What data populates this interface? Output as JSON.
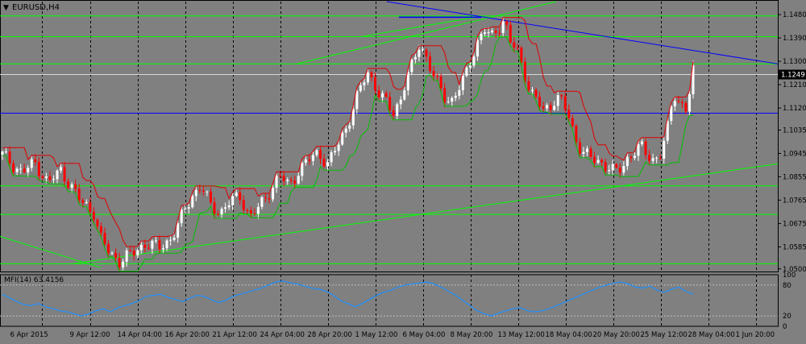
{
  "window": {
    "symbol_label": "EURUSD,H4",
    "current_price_label": "1.1249",
    "mfi_label": "MFI(14) 63.4156"
  },
  "colors": {
    "background": "#808080",
    "grid": "#000000",
    "bull_candle": "#ffffff",
    "bear_candle": "#ff0000",
    "green_lines": "#00ff00",
    "blue_lines": "#0000ff",
    "mfi_line": "#1e90ff"
  },
  "chart_data": [
    {
      "type": "candlestick",
      "symbol": "EURUSD",
      "timeframe": "H4",
      "y_ticks": [
        "1.1480",
        "1.1390",
        "1.1300",
        "1.1210",
        "1.1120",
        "1.1035",
        "1.0945",
        "1.0855",
        "1.0765",
        "1.0675",
        "1.0585",
        "1.0500"
      ],
      "ylim": [
        1.049,
        1.153
      ],
      "x_ticks": [
        "6 Apr 2015",
        "9 Apr 12:00",
        "14 Apr 04:00",
        "16 Apr 20:00",
        "21 Apr 12:00",
        "24 Apr 04:00",
        "28 Apr 20:00",
        "1 May 12:00",
        "6 May 04:00",
        "8 May 20:00",
        "13 May 12:00",
        "18 May 04:00",
        "20 May 20:00",
        "25 May 12:00",
        "28 May 04:00",
        "1 Jun 20:00"
      ],
      "price_path": [
        [
          0,
          1.094
        ],
        [
          6,
          1.087
        ],
        [
          10,
          1.091
        ],
        [
          14,
          1.083
        ],
        [
          18,
          1.088
        ],
        [
          24,
          1.076
        ],
        [
          28,
          1.072
        ],
        [
          30,
          1.062
        ],
        [
          33,
          1.056
        ],
        [
          36,
          1.053
        ],
        [
          40,
          1.056
        ],
        [
          44,
          1.06
        ],
        [
          48,
          1.058
        ],
        [
          52,
          1.062
        ],
        [
          55,
          1.07
        ],
        [
          58,
          1.078
        ],
        [
          61,
          1.082
        ],
        [
          64,
          1.074
        ],
        [
          67,
          1.072
        ],
        [
          70,
          1.076
        ],
        [
          73,
          1.078
        ],
        [
          76,
          1.07
        ],
        [
          79,
          1.074
        ],
        [
          82,
          1.08
        ],
        [
          85,
          1.086
        ],
        [
          88,
          1.082
        ],
        [
          91,
          1.088
        ],
        [
          94,
          1.092
        ],
        [
          97,
          1.095
        ],
        [
          100,
          1.09
        ],
        [
          103,
          1.098
        ],
        [
          106,
          1.106
        ],
        [
          108,
          1.113
        ],
        [
          110,
          1.12
        ],
        [
          112,
          1.126
        ],
        [
          114,
          1.122
        ],
        [
          116,
          1.116
        ],
        [
          118,
          1.114
        ],
        [
          120,
          1.11
        ],
        [
          122,
          1.115
        ],
        [
          124,
          1.123
        ],
        [
          126,
          1.129
        ],
        [
          128,
          1.137
        ],
        [
          130,
          1.132
        ],
        [
          132,
          1.125
        ],
        [
          134,
          1.12
        ],
        [
          136,
          1.116
        ],
        [
          138,
          1.115
        ],
        [
          140,
          1.119
        ],
        [
          142,
          1.124
        ],
        [
          144,
          1.132
        ],
        [
          146,
          1.138
        ],
        [
          148,
          1.142
        ],
        [
          150,
          1.139
        ],
        [
          152,
          1.143
        ],
        [
          154,
          1.146
        ],
        [
          156,
          1.137
        ],
        [
          158,
          1.134
        ],
        [
          160,
          1.127
        ],
        [
          162,
          1.118
        ],
        [
          164,
          1.115
        ],
        [
          166,
          1.111
        ],
        [
          168,
          1.113
        ],
        [
          170,
          1.116
        ],
        [
          172,
          1.114
        ],
        [
          174,
          1.108
        ],
        [
          176,
          1.1
        ],
        [
          178,
          1.095
        ],
        [
          180,
          1.093
        ],
        [
          182,
          1.092
        ],
        [
          184,
          1.091
        ],
        [
          186,
          1.089
        ],
        [
          188,
          1.087
        ],
        [
          190,
          1.089
        ],
        [
          192,
          1.093
        ],
        [
          194,
          1.095
        ],
        [
          196,
          1.097
        ],
        [
          198,
          1.094
        ],
        [
          200,
          1.092
        ],
        [
          202,
          1.094
        ],
        [
          204,
          1.103
        ],
        [
          206,
          1.118
        ],
        [
          208,
          1.114
        ],
        [
          210,
          1.111
        ],
        [
          212,
          1.126
        ]
      ],
      "lines": [
        {
          "kind": "horizontal",
          "price": 1.1475,
          "color": "green"
        },
        {
          "kind": "horizontal",
          "price": 1.1395,
          "color": "green"
        },
        {
          "kind": "horizontal",
          "price": 1.129,
          "color": "green"
        },
        {
          "kind": "horizontal",
          "price": 1.11,
          "color": "blue"
        },
        {
          "kind": "horizontal",
          "price": 1.082,
          "color": "green"
        },
        {
          "kind": "horizontal",
          "price": 1.071,
          "color": "green"
        },
        {
          "kind": "horizontal",
          "price": 1.052,
          "color": "green"
        },
        {
          "kind": "horizontal",
          "price": 1.1249,
          "color": "white"
        }
      ],
      "current_price": 1.1249
    },
    {
      "type": "line",
      "indicator": "MFI(14)",
      "last_value": 63.4156,
      "y_ticks": [
        "100",
        "80",
        "20",
        "0"
      ],
      "ylim": [
        0,
        100
      ],
      "values": [
        62,
        55,
        48,
        42,
        40,
        44,
        38,
        34,
        30,
        28,
        24,
        20,
        24,
        30,
        34,
        28,
        36,
        40,
        44,
        50,
        58,
        60,
        62,
        56,
        52,
        48,
        54,
        60,
        58,
        52,
        46,
        50,
        58,
        62,
        66,
        70,
        74,
        80,
        86,
        88,
        84,
        82,
        78,
        74,
        72,
        68,
        60,
        50,
        44,
        38,
        44,
        52,
        60,
        66,
        70,
        76,
        80,
        82,
        84,
        86,
        82,
        76,
        68,
        60,
        50,
        40,
        30,
        24,
        20,
        26,
        30,
        34,
        36,
        30,
        28,
        30,
        34,
        40,
        46,
        52,
        58,
        64,
        70,
        76,
        80,
        84,
        86,
        82,
        76,
        74,
        78,
        70,
        66,
        72,
        76,
        68,
        62
      ]
    }
  ]
}
